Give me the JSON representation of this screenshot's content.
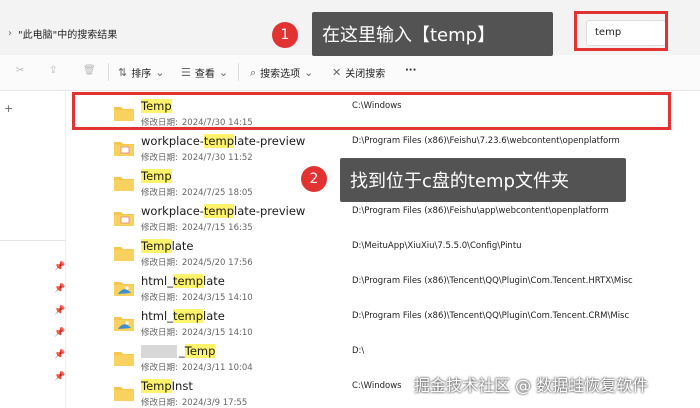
{
  "breadcrumb": {
    "text": "\"此电脑\"中的搜索结果"
  },
  "search": {
    "value": "temp"
  },
  "annotations": {
    "step1_number": "1",
    "step1_text": "在这里输入【temp】",
    "step2_number": "2",
    "step2_text": "找到位于c盘的temp文件夹"
  },
  "toolbar": {
    "sort_label": "排序",
    "view_label": "查看",
    "search_options_label": "搜索选项",
    "close_search_label": "关闭搜索",
    "more_label": "···"
  },
  "files": [
    {
      "name_pre": "",
      "name_hl": "Temp",
      "name_post": "",
      "date_label": "修改日期:",
      "date": "2024/7/30 14:15",
      "path": "C:\\Windows",
      "icon": "folder-icon"
    },
    {
      "name_pre": "workplace-",
      "name_hl": "temp",
      "name_post": "late-preview",
      "date_label": "修改日期:",
      "date": "2024/7/30 11:52",
      "path": "D:\\Program Files (x86)\\Feishu\\7.23.6\\webcontent\\openplatform",
      "icon": "folder-app-icon"
    },
    {
      "name_pre": "",
      "name_hl": "Temp",
      "name_post": "",
      "date_label": "修改日期:",
      "date": "2024/7/25 18:05",
      "path": "",
      "icon": "folder-icon"
    },
    {
      "name_pre": "workplace-",
      "name_hl": "temp",
      "name_post": "late-preview",
      "date_label": "修改日期:",
      "date": "2024/7/15 16:35",
      "path": "D:\\Program Files (x86)\\Feishu\\app\\webcontent\\openplatform",
      "icon": "folder-app-icon"
    },
    {
      "name_pre": "",
      "name_hl": "Temp",
      "name_post": "late",
      "date_label": "修改日期:",
      "date": "2024/5/20 17:56",
      "path": "D:\\MeituApp\\XiuXiu\\7.5.5.0\\Config\\Pintu",
      "icon": "folder-icon"
    },
    {
      "name_pre": "html_",
      "name_hl": "temp",
      "name_post": "late",
      "date_label": "修改日期:",
      "date": "2024/3/15 14:10",
      "path": "D:\\Program Files (x86)\\Tencent\\QQ\\Plugin\\Com.Tencent.HRTX\\Misc",
      "icon": "folder-image-icon"
    },
    {
      "name_pre": "html_",
      "name_hl": "temp",
      "name_post": "late",
      "date_label": "修改日期:",
      "date": "2024/3/15 14:10",
      "path": "D:\\Program Files (x86)\\Tencent\\QQ\\Plugin\\Com.Tencent.CRM\\Misc",
      "icon": "folder-image-icon"
    },
    {
      "name_pre": "_",
      "name_hl": "Temp",
      "name_post": "",
      "date_label": "修改日期:",
      "date": "2024/3/11 10:04",
      "path": "D:\\",
      "icon": "folder-icon"
    },
    {
      "name_pre": "",
      "name_hl": "Temp",
      "name_post": "Inst",
      "date_label": "修改日期:",
      "date": "2024/3/9 17:55",
      "path": "C:\\Windows",
      "icon": "folder-icon"
    }
  ],
  "watermark": "掘金技术社区 @ 数据蛙恢复软件",
  "colors": {
    "accent_red": "#e23232",
    "match_highlight": "#fff36b",
    "folder_yellow": "#f7c64c"
  }
}
